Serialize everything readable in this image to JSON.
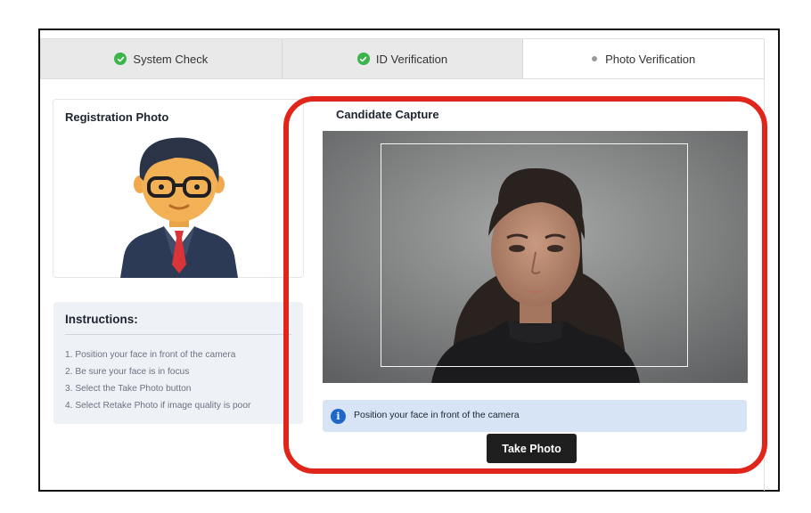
{
  "tabs": [
    {
      "label": "System Check",
      "status": "complete",
      "icon": "check-circle-icon"
    },
    {
      "label": "ID Verification",
      "status": "complete",
      "icon": "check-circle-icon"
    },
    {
      "label": "Photo Verification",
      "status": "active",
      "icon": "dot-icon"
    }
  ],
  "registration": {
    "title": "Registration Photo",
    "avatar": "person-avatar-illustration"
  },
  "instructions": {
    "title": "Instructions:",
    "items": [
      "1. Position your face in front of the camera",
      "2. Be sure your face is in focus",
      "3. Select the Take Photo button",
      "4. Select Retake Photo if image quality is poor"
    ]
  },
  "capture": {
    "title": "Candidate Capture",
    "info_icon": "info-icon",
    "info_message": "Position your face in front of the camera",
    "take_photo_label": "Take Photo"
  },
  "colors": {
    "accent_highlight": "#e1251b",
    "check_green": "#3ab54a",
    "info_blue": "#1f67c8",
    "info_bg": "#d7e4f6",
    "button_dark": "#1f1f1f"
  }
}
